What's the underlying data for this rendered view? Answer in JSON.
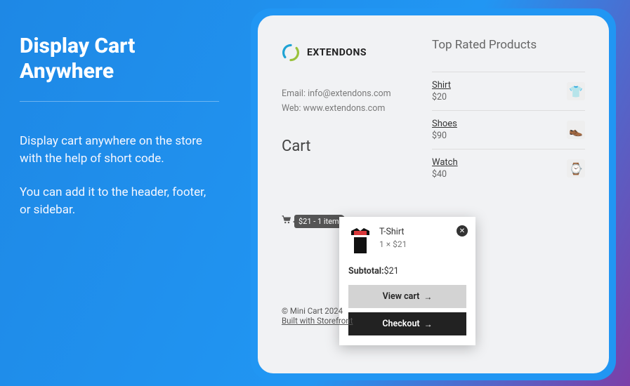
{
  "hero": {
    "title": "Display Cart Anywhere",
    "blurb1": "Display cart anywhere on the store with the help of short code.",
    "blurb2": "You can add it to the header, footer, or sidebar."
  },
  "brand": {
    "name": "EXTENDONS"
  },
  "contact": {
    "email": "Email: info@extendons.com",
    "web": "Web: www.extendons.com"
  },
  "cart_heading": "Cart",
  "toprated_heading": "Top Rated Products",
  "products": [
    {
      "name": "Shirt",
      "price": "$20",
      "emoji": "👕"
    },
    {
      "name": "Shoes",
      "price": "$90",
      "emoji": "👞"
    },
    {
      "name": "Watch",
      "price": "$40",
      "emoji": "⌚"
    }
  ],
  "minicart_badge": "$21 -  1 item",
  "popup": {
    "item_name": "T-Shirt",
    "item_qty": "1 × $21",
    "subtotal_label": "Subtotal:",
    "subtotal_value": "$21",
    "view_cart": "View cart",
    "checkout": "Checkout"
  },
  "footer": {
    "copy": "© Mini Cart 2024",
    "built": "Built with Storefront"
  }
}
